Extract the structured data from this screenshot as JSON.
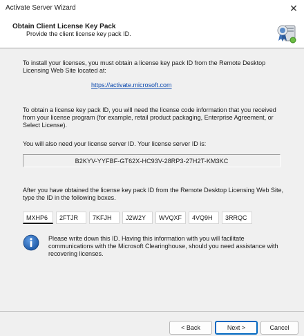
{
  "window": {
    "title": "Activate Server Wizard",
    "close_glyph": "✕"
  },
  "header": {
    "title": "Obtain Client License Key Pack",
    "subtitle": "Provide the client license key pack ID.",
    "icon": "certificate-server-icon"
  },
  "body": {
    "intro_text": "To install your licenses, you must obtain a license key pack ID from the Remote Desktop Licensing Web Site located at:",
    "website_link": "https://activate.microsoft.com",
    "license_code_text": "To obtain a license key pack ID, you will need the license code information that you received from your license program (for example, retail product packaging, Enterprise Agreement, or Select License).",
    "server_id_label": "You will also need your license server ID. Your license server ID is:",
    "server_id_value": "B2KYV-YYFBF-GT62X-HC93V-28RP3-27H2T-KM3KC",
    "key_pack_instructions": "After you have obtained the license key pack ID from the Remote Desktop Licensing Web Site, type the ID in the following boxes.",
    "key_pack_id_fields": [
      "MXHP6",
      "2FTJR",
      "7KFJH",
      "J2W2Y",
      "WVQXF",
      "4VQ9H",
      "3RRQC"
    ],
    "info_icon": "info-icon",
    "info_text": "Please write down this ID. Having this information with you will facilitate communications with the Microsoft Clearinghouse, should you need assistance with recovering licenses."
  },
  "footer": {
    "back_label": "< Back",
    "next_label": "Next >",
    "cancel_label": "Cancel"
  },
  "colors": {
    "link": "#0645ad",
    "accent": "#0067c0",
    "background": "#f0f0f0",
    "info_icon_blue": "#1e5aa8"
  }
}
